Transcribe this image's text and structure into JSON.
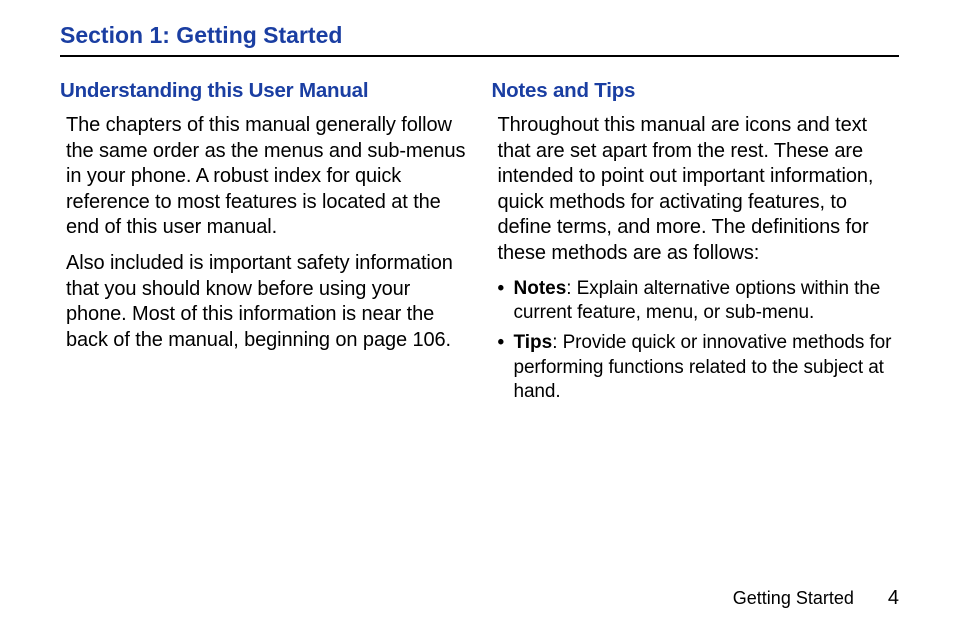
{
  "title": "Section 1: Getting Started",
  "left": {
    "heading": "Understanding this User Manual",
    "p1": "The chapters of this manual generally follow the same order as the menus and sub-menus in your phone. A robust index for quick reference to most features is located at the end of this user manual.",
    "p2": "Also included is important safety information that you should know before using your phone. Most of this information is near the back of the manual, beginning on page 106."
  },
  "right": {
    "heading": "Notes and Tips",
    "p1": "Throughout this manual are icons and text that are set apart from the rest. These are intended to point out important information, quick methods for activating features, to define terms, and more. The definitions for these methods are as follows:",
    "b1_term": "Notes",
    "b1_rest": ": Explain alternative options within the current feature, menu, or sub-menu.",
    "b2_term": "Tips",
    "b2_rest": ": Provide quick or innovative methods for performing functions related to the subject at hand."
  },
  "footer": {
    "section": "Getting Started",
    "page": "4"
  }
}
